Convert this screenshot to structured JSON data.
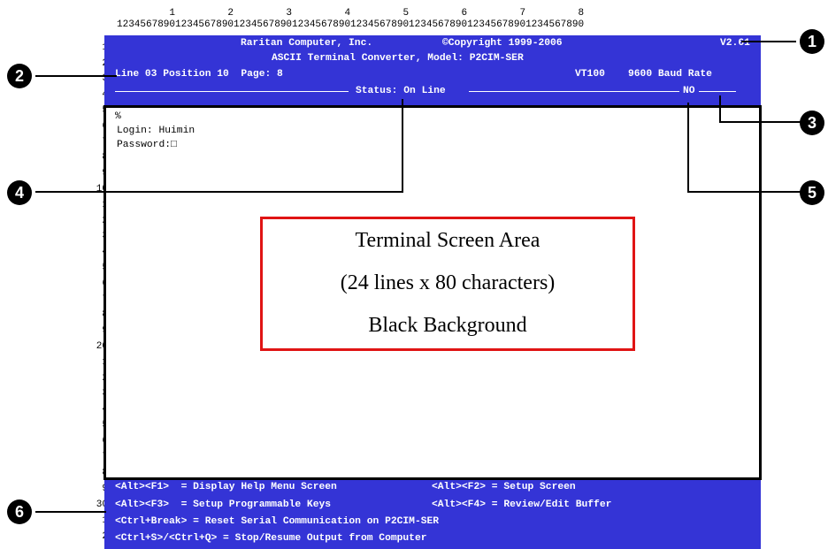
{
  "ruler": {
    "tens": "         1         2         3         4         5         6         7         8",
    "units": "12345678901234567890123456789012345678901234567890123456789012345678901234567890"
  },
  "row_numbers": [
    "1",
    "2",
    "3",
    "4",
    "5",
    "6",
    "7",
    "8",
    "9",
    "10",
    "1",
    "2",
    "3",
    "4",
    "5",
    "6",
    "7",
    "8",
    "9",
    "20",
    "1",
    "2",
    "3",
    "4",
    "5",
    "6",
    "7",
    "8",
    "9",
    "30",
    "1",
    "2"
  ],
  "status_bar": {
    "company": "Raritan Computer, Inc.",
    "copyright": "©Copyright 1999-2006",
    "version": "V2.61",
    "product": "ASCII Terminal Converter, Model: P2CIM-SER",
    "position": "Line 03 Position 10  Page: 8",
    "terminal_type": "VT100",
    "baud": "9600 Baud Rate",
    "status": "Status: On Line",
    "flag": "NO"
  },
  "terminal": {
    "lines": [
      "%",
      "Login: Huimin",
      "Password:□"
    ],
    "area_label": [
      "Terminal Screen Area",
      "(24 lines x 80 characters)",
      "Black Background"
    ]
  },
  "help_bar": {
    "row1_left": "<Alt><F1>  = Display Help Menu Screen",
    "row1_right": "<Alt><F2> = Setup Screen",
    "row2_left": "<Alt><F3>  = Setup Programmable Keys",
    "row2_right": "<Alt><F4> = Review/Edit Buffer",
    "row3": "<Ctrl+Break> = Reset Serial Communication on P2CIM-SER",
    "row4": "<Ctrl+S>/<Ctrl+Q> = Stop/Resume Output from Computer"
  },
  "callouts": [
    "1",
    "2",
    "3",
    "4",
    "5",
    "6"
  ],
  "colors": {
    "panel": "#3434d6",
    "area_border": "#e01414"
  }
}
